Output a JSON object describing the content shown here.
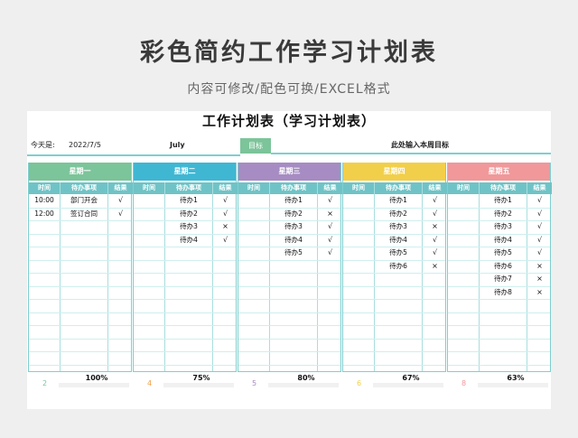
{
  "hero": {
    "title": "彩色简约工作学习计划表",
    "subtitle": "内容可修改/配色可换/EXCEL格式"
  },
  "sheet": {
    "title": "工作计划表（学习计划表）",
    "today_label": "今天是:",
    "date": "2022/7/5",
    "month": "July",
    "goal_label": "目标",
    "goal_text": "此处输入本周目标"
  },
  "columns": {
    "time": "时间",
    "todo": "待办事项",
    "result": "结果"
  },
  "days": [
    {
      "name": "星期一",
      "color": "#7cc49a",
      "rows": [
        {
          "time": "10:00",
          "todo": "部门开会",
          "result": "√"
        },
        {
          "time": "12:00",
          "todo": "签订合同",
          "result": "√"
        }
      ],
      "done": 2,
      "progress": "100%",
      "ratio": 1.0,
      "count_color": "#7cc49a"
    },
    {
      "name": "星期二",
      "color": "#3fb7d3",
      "rows": [
        {
          "time": "",
          "todo": "待办1",
          "result": "√"
        },
        {
          "time": "",
          "todo": "待办2",
          "result": "√"
        },
        {
          "time": "",
          "todo": "待办3",
          "result": "×"
        },
        {
          "time": "",
          "todo": "待办4",
          "result": "√"
        }
      ],
      "done": 4,
      "progress": "75%",
      "ratio": 0.75,
      "count_color": "#f0a04a"
    },
    {
      "name": "星期三",
      "color": "#a68cc2",
      "rows": [
        {
          "time": "",
          "todo": "待办1",
          "result": "√"
        },
        {
          "time": "",
          "todo": "待办2",
          "result": "×"
        },
        {
          "time": "",
          "todo": "待办3",
          "result": "√"
        },
        {
          "time": "",
          "todo": "待办4",
          "result": "√"
        },
        {
          "time": "",
          "todo": "待办5",
          "result": "√"
        }
      ],
      "done": 5,
      "progress": "80%",
      "ratio": 0.8,
      "count_color": "#a68cc2"
    },
    {
      "name": "星期四",
      "color": "#f2cf4a",
      "rows": [
        {
          "time": "",
          "todo": "待办1",
          "result": "√"
        },
        {
          "time": "",
          "todo": "待办2",
          "result": "√"
        },
        {
          "time": "",
          "todo": "待办3",
          "result": "×"
        },
        {
          "time": "",
          "todo": "待办4",
          "result": "√"
        },
        {
          "time": "",
          "todo": "待办5",
          "result": "√"
        },
        {
          "time": "",
          "todo": "待办6",
          "result": "×"
        }
      ],
      "done": 6,
      "progress": "67%",
      "ratio": 0.67,
      "count_color": "#f2cf4a"
    },
    {
      "name": "星期五",
      "color": "#f0989a",
      "rows": [
        {
          "time": "",
          "todo": "待办1",
          "result": "√"
        },
        {
          "time": "",
          "todo": "待办2",
          "result": "√"
        },
        {
          "time": "",
          "todo": "待办3",
          "result": "√"
        },
        {
          "time": "",
          "todo": "待办4",
          "result": "√"
        },
        {
          "time": "",
          "todo": "待办5",
          "result": "√"
        },
        {
          "time": "",
          "todo": "待办6",
          "result": "×"
        },
        {
          "time": "",
          "todo": "待办7",
          "result": "×"
        },
        {
          "time": "",
          "todo": "待办8",
          "result": "×"
        }
      ],
      "done": 8,
      "progress": "63%",
      "ratio": 0.63,
      "count_color": "#f0989a"
    }
  ]
}
